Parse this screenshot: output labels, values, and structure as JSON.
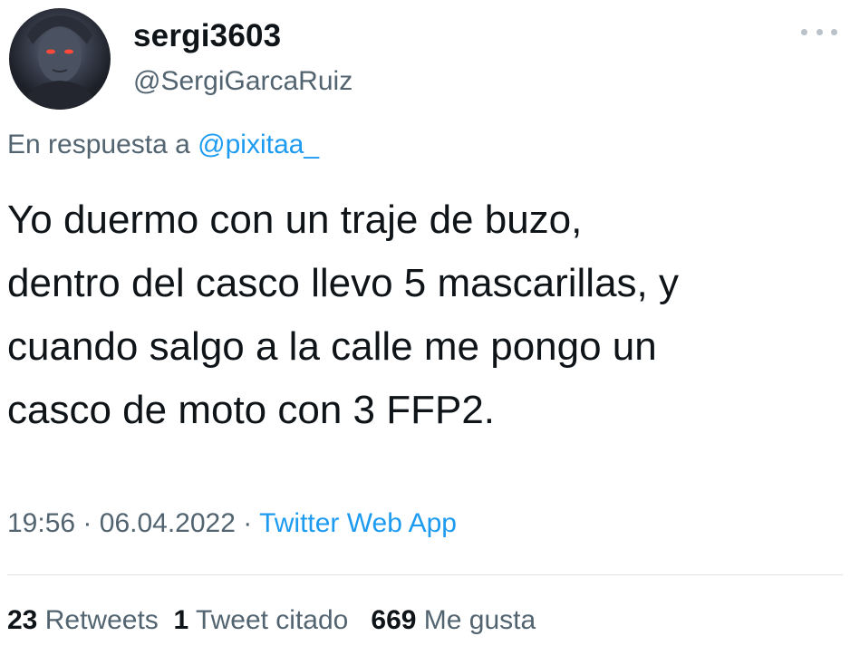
{
  "author": {
    "display_name": "sergi3603",
    "handle": "@SergiGarcaRuiz",
    "avatar_icon": "profile-avatar"
  },
  "more_icon": "more-horizontal-icon",
  "reply": {
    "prefix": "En respuesta a",
    "mention": "@pixitaa_"
  },
  "tweet": {
    "text": "Yo duermo con un traje de buzo,\ndentro del casco llevo 5 mascarillas, y\ncuando salgo a la calle me pongo un\ncasco de moto con 3 FFP2."
  },
  "meta": {
    "time": "19:56",
    "separator": "·",
    "date": "06.04.2022",
    "source": "Twitter Web App"
  },
  "stats": {
    "retweets_count": "23",
    "retweets_label": "Retweets",
    "quotes_count": "1",
    "quotes_label": "Tweet citado",
    "likes_count": "669",
    "likes_label": "Me gusta"
  },
  "colors": {
    "text": "#0f1419",
    "secondary": "#536471",
    "link": "#1d9bf0",
    "divider": "#dfe3e6"
  }
}
